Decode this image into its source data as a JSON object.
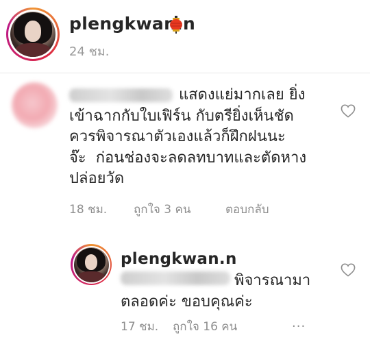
{
  "post": {
    "username": "plengkwan.n",
    "badge_icon": "red-lantern-icon",
    "time": "24 ชม."
  },
  "comments": [
    {
      "author_blurred": true,
      "text": "แสดงแย่มากเลย ยิ่ง\nเข้าฉากกับใบเฟิร์น กับตรียิ่งเห็นชัด\nควรพิจารณาตัวเองแล้วก็ฝึกฝนนะ\nจ๊ะ  ก่อนช่องจะลดลทบาทและตัดหาง\nปล่อยวัด",
      "time": "18 ชม.",
      "likes": "ถูกใจ 3 คน",
      "reply": "ตอบกลับ"
    }
  ],
  "reply": {
    "username": "plengkwan.n",
    "mention_blurred": true,
    "text": "พิจารณามา\nตลอดค่ะ ขอบคุณค่ะ",
    "time": "17 ชม.",
    "likes": "ถูกใจ 16 คน",
    "more": "..."
  },
  "colors": {
    "text": "#262626",
    "muted": "#8e8e8e",
    "divider": "#e6e6e6",
    "lantern": "#e8381f"
  }
}
